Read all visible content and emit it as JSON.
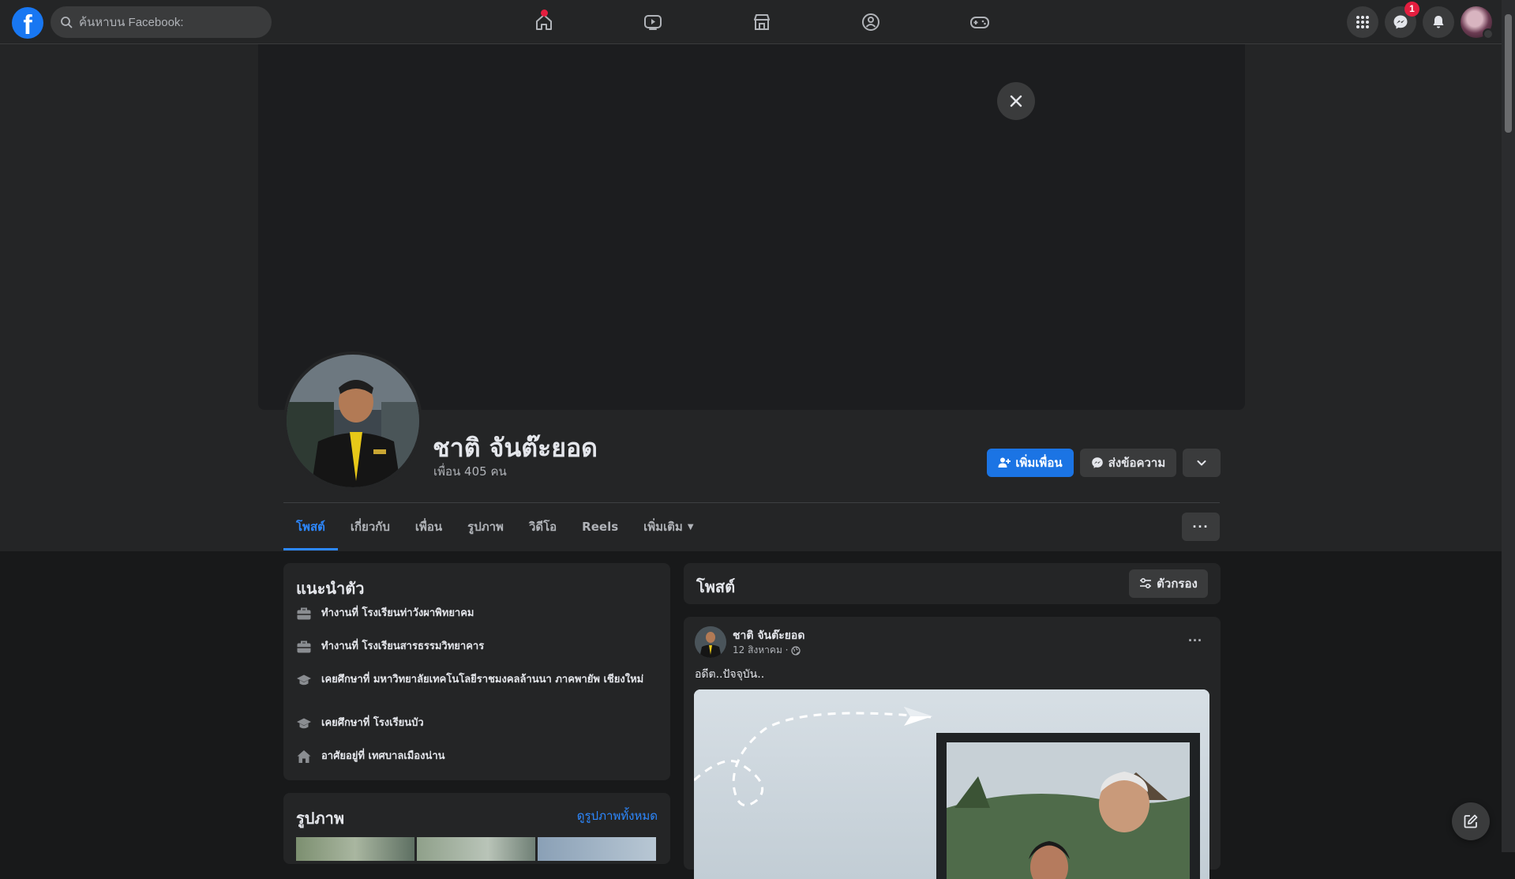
{
  "topbar": {
    "logo": "f",
    "search_placeholder": "ค้นหาบน Facebook:",
    "nav_icons": [
      "home-icon",
      "watch-icon",
      "marketplace-icon",
      "groups-icon",
      "gaming-icon"
    ],
    "messenger_badge": "1"
  },
  "profile": {
    "name": "ชาติ จันต๊ะยอด",
    "friends": "เพื่อน 405 คน",
    "add_friend_label": "เพิ่มเพื่อน",
    "message_label": "ส่งข้อความ"
  },
  "tabs": [
    {
      "label": "โพสต์",
      "active": true
    },
    {
      "label": "เกี่ยวกับ",
      "active": false
    },
    {
      "label": "เพื่อน",
      "active": false
    },
    {
      "label": "รูปภาพ",
      "active": false
    },
    {
      "label": "วิดีโอ",
      "active": false
    },
    {
      "label": "Reels",
      "active": false
    },
    {
      "label": "เพิ่มเติม",
      "active": false
    }
  ],
  "intro": {
    "title": "แนะนำตัว",
    "items": [
      {
        "icon": "briefcase-icon",
        "text": "ทำงานที่ โรงเรียนท่าวังผาพิทยาคม"
      },
      {
        "icon": "briefcase-icon",
        "text": "ทำงานที่ โรงเรียนสารธรรมวิทยาคาร"
      },
      {
        "icon": "graduation-cap-icon",
        "text": "เคยศึกษาที่ มหาวิทยาลัยเทคโนโลยีราชมงคลล้านนา ภาคพายัพ เชียงใหม่"
      },
      {
        "icon": "graduation-cap-icon",
        "text": "เคยศึกษาที่ โรงเรียนบัว"
      },
      {
        "icon": "house-icon",
        "text": "อาศัยอยู่ที่ เทศบาลเมืองน่าน"
      }
    ]
  },
  "photos": {
    "title": "รูปภาพ",
    "see_all": "ดูรูปภาพทั้งหมด"
  },
  "posts": {
    "title": "โพสต์",
    "filter_label": "ตัวกรอง",
    "post": {
      "author": "ชาติ จันต๊ะยอด",
      "date": "12 สิงหาคม ·",
      "text": "อดีต..ปัจจุบัน.."
    }
  }
}
